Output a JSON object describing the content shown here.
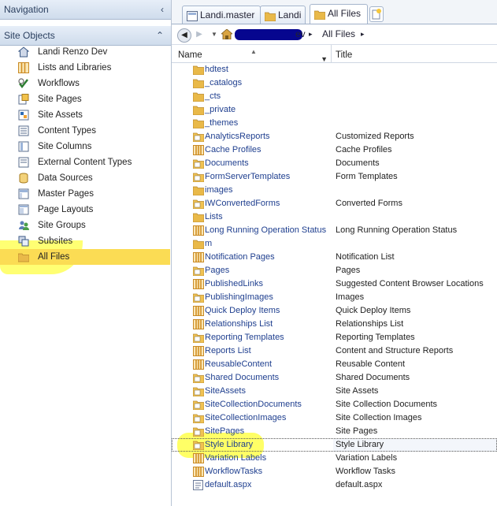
{
  "navigation": {
    "title": "Navigation",
    "collapse_glyph": "‹"
  },
  "site_objects": {
    "title": "Site Objects",
    "collapse_glyph": "⌃",
    "items": [
      {
        "label": "Landi Renzo Dev",
        "icon": "site-icon"
      },
      {
        "label": "Lists and Libraries",
        "icon": "lists-icon"
      },
      {
        "label": "Workflows",
        "icon": "workflow-icon"
      },
      {
        "label": "Site Pages",
        "icon": "pages-icon"
      },
      {
        "label": "Site Assets",
        "icon": "assets-icon"
      },
      {
        "label": "Content Types",
        "icon": "content-types-icon"
      },
      {
        "label": "Site Columns",
        "icon": "columns-icon"
      },
      {
        "label": "External Content Types",
        "icon": "external-icon"
      },
      {
        "label": "Data Sources",
        "icon": "datasource-icon"
      },
      {
        "label": "Master Pages",
        "icon": "master-icon"
      },
      {
        "label": "Page Layouts",
        "icon": "layout-icon"
      },
      {
        "label": "Site Groups",
        "icon": "groups-icon"
      },
      {
        "label": "Subsites",
        "icon": "subsites-icon"
      },
      {
        "label": "All Files",
        "icon": "folder-icon",
        "selected": true
      }
    ]
  },
  "tabs": [
    {
      "label": "Landi.master",
      "icon": "master-page-icon"
    },
    {
      "label": "Landi",
      "icon": "folder-icon"
    },
    {
      "label": "All Files",
      "icon": "folder-icon",
      "active": true
    }
  ],
  "address": {
    "suffix": "ev",
    "separator": "▸",
    "current": "All Files",
    "trail_arrow": "▸"
  },
  "columns": {
    "name": "Name",
    "title": "Title"
  },
  "rows": [
    {
      "name": "hdtest",
      "title": "",
      "type": "folder"
    },
    {
      "name": "_catalogs",
      "title": "",
      "type": "folder"
    },
    {
      "name": "_cts",
      "title": "",
      "type": "folder"
    },
    {
      "name": "_private",
      "title": "",
      "type": "folder"
    },
    {
      "name": "_themes",
      "title": "",
      "type": "folder"
    },
    {
      "name": "AnalyticsReports",
      "title": "Customized Reports",
      "type": "library"
    },
    {
      "name": "Cache Profiles",
      "title": "Cache Profiles",
      "type": "list"
    },
    {
      "name": "Documents",
      "title": "Documents",
      "type": "library"
    },
    {
      "name": "FormServerTemplates",
      "title": "Form Templates",
      "type": "library"
    },
    {
      "name": "images",
      "title": "",
      "type": "folder"
    },
    {
      "name": "IWConvertedForms",
      "title": "Converted Forms",
      "type": "library"
    },
    {
      "name": "Lists",
      "title": "",
      "type": "folder"
    },
    {
      "name": "Long Running Operation Status",
      "title": "Long Running Operation Status",
      "type": "list"
    },
    {
      "name": "m",
      "title": "",
      "type": "folder"
    },
    {
      "name": "Notification Pages",
      "title": "Notification List",
      "type": "list"
    },
    {
      "name": "Pages",
      "title": "Pages",
      "type": "library"
    },
    {
      "name": "PublishedLinks",
      "title": "Suggested Content Browser Locations",
      "type": "list"
    },
    {
      "name": "PublishingImages",
      "title": "Images",
      "type": "library"
    },
    {
      "name": "Quick Deploy Items",
      "title": "Quick Deploy Items",
      "type": "list"
    },
    {
      "name": "Relationships List",
      "title": "Relationships List",
      "type": "list"
    },
    {
      "name": "Reporting Templates",
      "title": "Reporting Templates",
      "type": "library"
    },
    {
      "name": "Reports List",
      "title": "Content and Structure Reports",
      "type": "list"
    },
    {
      "name": "ReusableContent",
      "title": "Reusable Content",
      "type": "list"
    },
    {
      "name": "Shared Documents",
      "title": "Shared Documents",
      "type": "library"
    },
    {
      "name": "SiteAssets",
      "title": "Site Assets",
      "type": "library"
    },
    {
      "name": "SiteCollectionDocuments",
      "title": "Site Collection Documents",
      "type": "library"
    },
    {
      "name": "SiteCollectionImages",
      "title": "Site Collection Images",
      "type": "library"
    },
    {
      "name": "SitePages",
      "title": "Site Pages",
      "type": "library"
    },
    {
      "name": "Style Library",
      "title": "Style Library",
      "type": "library",
      "selected": true
    },
    {
      "name": "Variation Labels",
      "title": "Variation Labels",
      "type": "list"
    },
    {
      "name": "WorkflowTasks",
      "title": "Workflow Tasks",
      "type": "list"
    },
    {
      "name": "default.aspx",
      "title": "default.aspx",
      "type": "file"
    }
  ],
  "colors": {
    "highlight": "#ffff00",
    "selected_nav": "#fbdc54",
    "link": "#1f3f8f",
    "folder": "#e9b949"
  }
}
